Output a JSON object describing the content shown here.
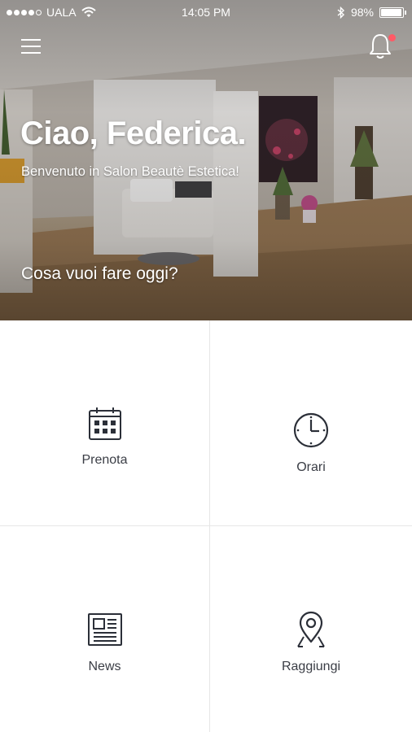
{
  "status_bar": {
    "carrier": "UALA",
    "time": "14:05 PM",
    "battery": "98%",
    "battery_level": 0.98,
    "signal_bars_filled": 4,
    "signal_bars_total": 5
  },
  "header": {
    "menu_icon": "hamburger-menu-icon",
    "notifications_icon": "bell-icon",
    "notification_badge_color": "#ff5a66"
  },
  "hero": {
    "greeting": "Ciao, Federica.",
    "welcome": "Benvenuto in Salon Beautè Estetica!",
    "prompt": "Cosa vuoi fare oggi?"
  },
  "actions": [
    {
      "label": "Prenota",
      "icon": "calendar-icon"
    },
    {
      "label": "Orari",
      "icon": "clock-icon"
    },
    {
      "label": "News",
      "icon": "newspaper-icon"
    },
    {
      "label": "Raggiungi",
      "icon": "map-pin-icon"
    }
  ]
}
